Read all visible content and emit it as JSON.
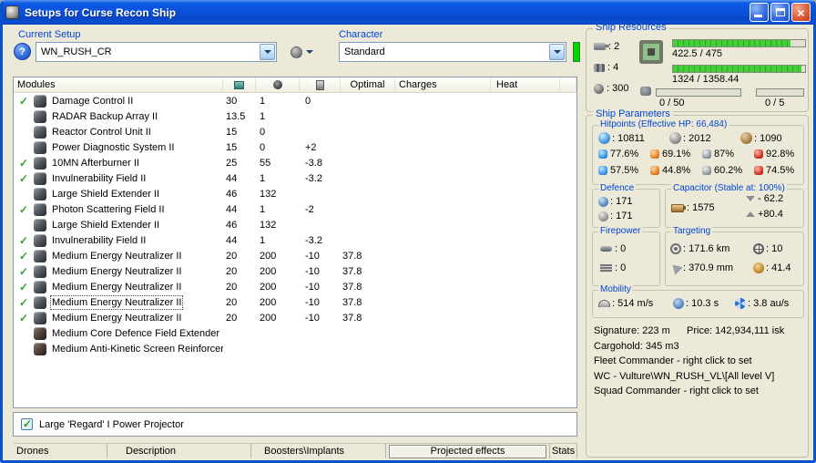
{
  "window": {
    "title": "Setups for Curse Recon Ship"
  },
  "icons": {
    "help": "?",
    "close": "×",
    "check": "✓"
  },
  "colors": {
    "titlebar_blue": "#0A52DC",
    "panel_beige": "#ECE9D8",
    "group_label_blue": "#0046D5",
    "resource_bar_green": "#44CE37",
    "active_check_green": "#2FA32F",
    "character_indicator_green": "#00D500"
  },
  "toolbar": {
    "current_setup_label": "Current Setup",
    "current_setup_value": "WN_RUSH_CR",
    "character_label": "Character",
    "character_value": "Standard"
  },
  "modules_table": {
    "headers": {
      "name": "Modules",
      "optimal": "Optimal",
      "charges": "Charges",
      "heat": "Heat"
    },
    "rows": [
      {
        "active": true,
        "name": "Damage Control II",
        "cpu": "30",
        "pg": "1",
        "cap": "0"
      },
      {
        "active": false,
        "name": "RADAR Backup Array II",
        "cpu": "13.5",
        "pg": "1"
      },
      {
        "active": false,
        "name": "Reactor Control Unit II",
        "cpu": "15",
        "pg": "0"
      },
      {
        "active": false,
        "name": "Power Diagnostic System II",
        "cpu": "15",
        "pg": "0",
        "cap": "+2"
      },
      {
        "active": true,
        "name": "10MN Afterburner II",
        "cpu": "25",
        "pg": "55",
        "cap": "-3.8"
      },
      {
        "active": true,
        "name": "Invulnerability Field II",
        "cpu": "44",
        "pg": "1",
        "cap": "-3.2"
      },
      {
        "active": false,
        "name": "Large Shield Extender II",
        "cpu": "46",
        "pg": "132"
      },
      {
        "active": true,
        "name": "Photon Scattering Field II",
        "cpu": "44",
        "pg": "1",
        "cap": "-2"
      },
      {
        "active": false,
        "name": "Large Shield Extender II",
        "cpu": "46",
        "pg": "132"
      },
      {
        "active": true,
        "name": "Invulnerability Field II",
        "cpu": "44",
        "pg": "1",
        "cap": "-3.2"
      },
      {
        "active": true,
        "name": "Medium Energy Neutralizer II",
        "cpu": "20",
        "pg": "200",
        "cap": "-10",
        "optimal": "37.8"
      },
      {
        "active": true,
        "name": "Medium Energy Neutralizer II",
        "cpu": "20",
        "pg": "200",
        "cap": "-10",
        "optimal": "37.8"
      },
      {
        "active": true,
        "name": "Medium Energy Neutralizer II",
        "cpu": "20",
        "pg": "200",
        "cap": "-10",
        "optimal": "37.8"
      },
      {
        "active": true,
        "name": "Medium Energy Neutralizer II",
        "cpu": "20",
        "pg": "200",
        "cap": "-10",
        "optimal": "37.8",
        "selected": true
      },
      {
        "active": true,
        "name": "Medium Energy Neutralizer II",
        "cpu": "20",
        "pg": "200",
        "cap": "-10",
        "optimal": "37.8"
      },
      {
        "active": false,
        "name": "Medium Core Defence Field Extender I",
        "rig": true
      },
      {
        "active": false,
        "name": "Medium Anti-Kinetic Screen Reinforcer I",
        "rig": true
      }
    ]
  },
  "projected_effects": {
    "checked": true,
    "label": "Large 'Regard' I Power Projector"
  },
  "bottom_tabs": [
    "Drones",
    "Description",
    "Boosters\\Implants",
    "Projected effects",
    "Stats"
  ],
  "ship_resources": {
    "title": "Ship Resources",
    "turrets": "2",
    "launchers": "4",
    "calibration": "300",
    "cpu_text": "422.5 / 475",
    "cpu_pct": 89,
    "powergrid_text": "1324 / 1358.44",
    "powergrid_pct": 97,
    "dronebay_text": "0 / 50",
    "dronebay_pct": 0,
    "drones_text": "0 / 5",
    "drones_pct": 0
  },
  "ship_parameters": {
    "title": "Ship Parameters",
    "hitpoints": {
      "title": "Hitpoints (Effective HP: 66,484)",
      "shield": "10811",
      "armor": "2012",
      "hull": "1090",
      "resists": [
        {
          "icon": "em-icon",
          "shield": "77.6%",
          "armor": "57.5%"
        },
        {
          "icon": "explosive-icon",
          "shield": "69.1%",
          "armor": "44.8%"
        },
        {
          "icon": "kinetic-icon",
          "shield": "87%",
          "armor": "60.2%"
        },
        {
          "icon": "thermal-icon",
          "shield": "92.8%",
          "armor": "74.5%"
        }
      ]
    },
    "defence": {
      "title": "Defence",
      "shield_value": "171",
      "armor_value": "171"
    },
    "capacitor": {
      "title": "Capacitor (Stable at: 100%)",
      "amount": "1575",
      "usage": "- 62.2",
      "recharge": "+80.4"
    },
    "firepower": {
      "title": "Firepower",
      "volley": "0",
      "dps": "0"
    },
    "targeting": {
      "title": "Targeting",
      "range": "171.6 km",
      "max_targets": "10",
      "scan_resolution": "370.9 mm",
      "sensor_strength": "41.4"
    },
    "mobility": {
      "title": "Mobility",
      "speed": "514 m/s",
      "align_time": "10.3 s",
      "warp_speed": "3.8 au/s"
    },
    "info": {
      "signature": "Signature: 223 m",
      "price": "Price: 142,934,111 isk",
      "cargohold": "Cargohold: 345 m3",
      "fleet_commander": "Fleet Commander - right click to set",
      "wing_commander": "WC - Vulture\\WN_RUSH_VL\\[All level V]",
      "squad_commander": "Squad Commander - right click to set"
    }
  }
}
